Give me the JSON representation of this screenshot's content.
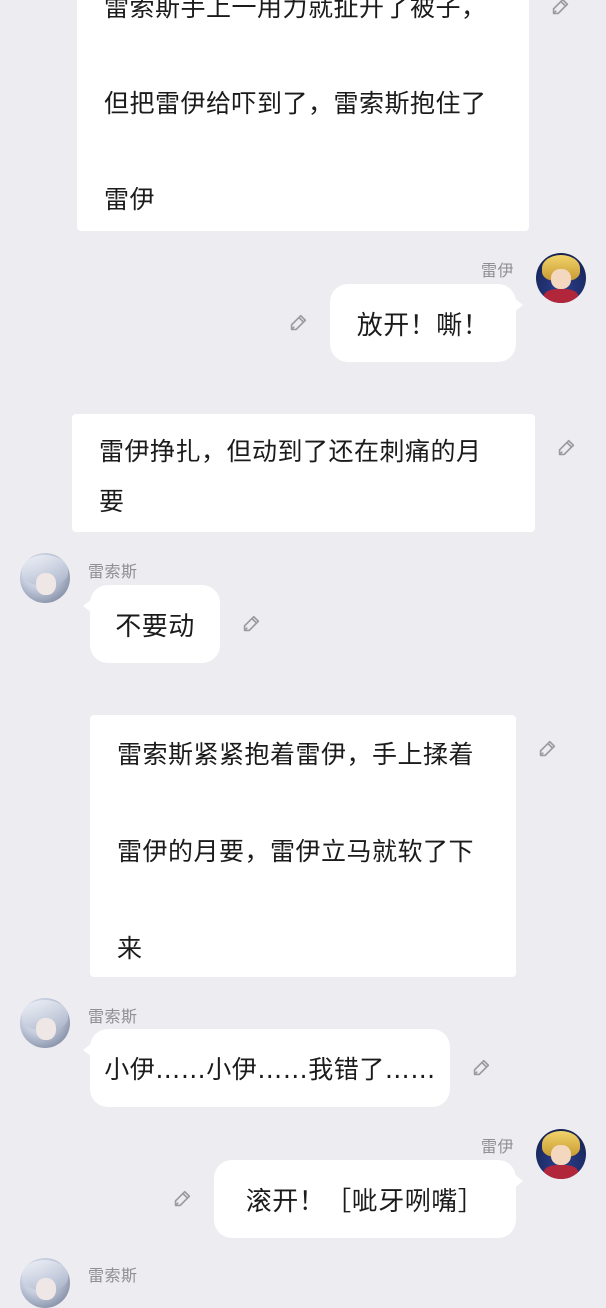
{
  "messages": [
    {
      "kind": "narration",
      "lines": [
        "雷索斯手上一用力就扯开了被子，",
        "但把雷伊给吓到了，雷索斯抱住了",
        "雷伊"
      ]
    },
    {
      "kind": "chat",
      "side": "right",
      "sender": "雷伊",
      "text": "放开！嘶！"
    },
    {
      "kind": "narration",
      "lines": [
        "雷伊挣扎，但动到了还在刺痛的月",
        "要"
      ]
    },
    {
      "kind": "chat",
      "side": "left",
      "sender": "雷索斯",
      "text": "不要动"
    },
    {
      "kind": "narration",
      "lines": [
        "雷索斯紧紧抱着雷伊，手上揉着",
        "雷伊的月要，雷伊立马就软了下",
        "来"
      ]
    },
    {
      "kind": "chat",
      "side": "left",
      "sender": "雷索斯",
      "text": "小伊……小伊……我错了……"
    },
    {
      "kind": "chat",
      "side": "right",
      "sender": "雷伊",
      "text": "滚开！［呲牙咧嘴］"
    },
    {
      "kind": "chat",
      "side": "left",
      "sender": "雷索斯",
      "text": ""
    }
  ],
  "icons": {
    "edit": "edit-pencil-icon",
    "avatar_left": "reisus-avatar",
    "avatar_right": "rean-avatar"
  }
}
